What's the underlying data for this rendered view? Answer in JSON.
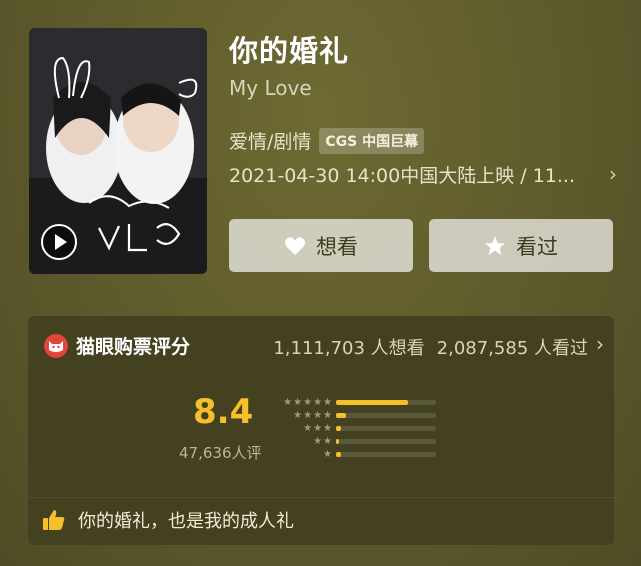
{
  "movie": {
    "title": "你的婚礼",
    "subtitle": "My Love",
    "genre": "爱情/剧情",
    "badge": "CGS 中国巨幕",
    "release": "2021-04-30 14:00中国大陆上映 / 11..."
  },
  "actions": {
    "want_label": "想看",
    "seen_label": "看过"
  },
  "rating_card": {
    "title": "猫眼购票评分",
    "want_count": "1,111,703 人想看",
    "seen_count": "2,087,585 人看过",
    "score": "8.4",
    "raters": "47,636人评",
    "distribution": [
      {
        "stars": 5,
        "fraction": 0.72
      },
      {
        "stars": 4,
        "fraction": 0.1
      },
      {
        "stars": 3,
        "fraction": 0.05
      },
      {
        "stars": 2,
        "fraction": 0.03
      },
      {
        "stars": 1,
        "fraction": 0.05
      }
    ],
    "quote": "你的婚礼，也是我的成人礼"
  },
  "colors": {
    "accent": "#f7c02a",
    "brand_red": "#e2463a"
  },
  "icons": {
    "play": "play-icon",
    "heart": "heart-icon",
    "star": "star-icon",
    "cat": "maoyan-cat-icon",
    "chevron": "chevron-right-icon",
    "thumbs": "thumbs-up-icon"
  }
}
